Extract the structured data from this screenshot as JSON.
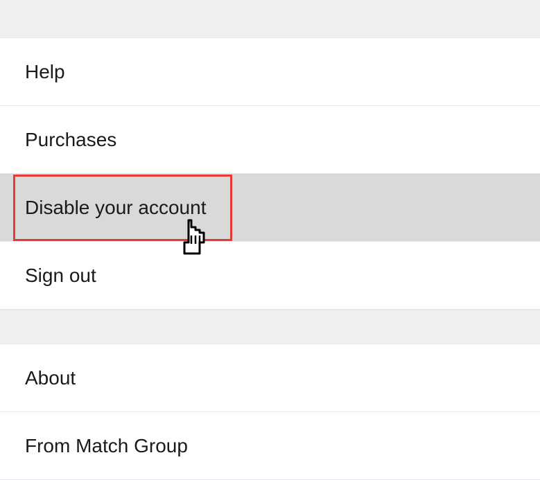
{
  "menu": {
    "section1": [
      {
        "label": "Help"
      },
      {
        "label": "Purchases"
      },
      {
        "label": "Disable your account"
      },
      {
        "label": "Sign out"
      }
    ],
    "section2": [
      {
        "label": "About"
      },
      {
        "label": "From Match Group"
      }
    ]
  },
  "highlighted_index": 2
}
